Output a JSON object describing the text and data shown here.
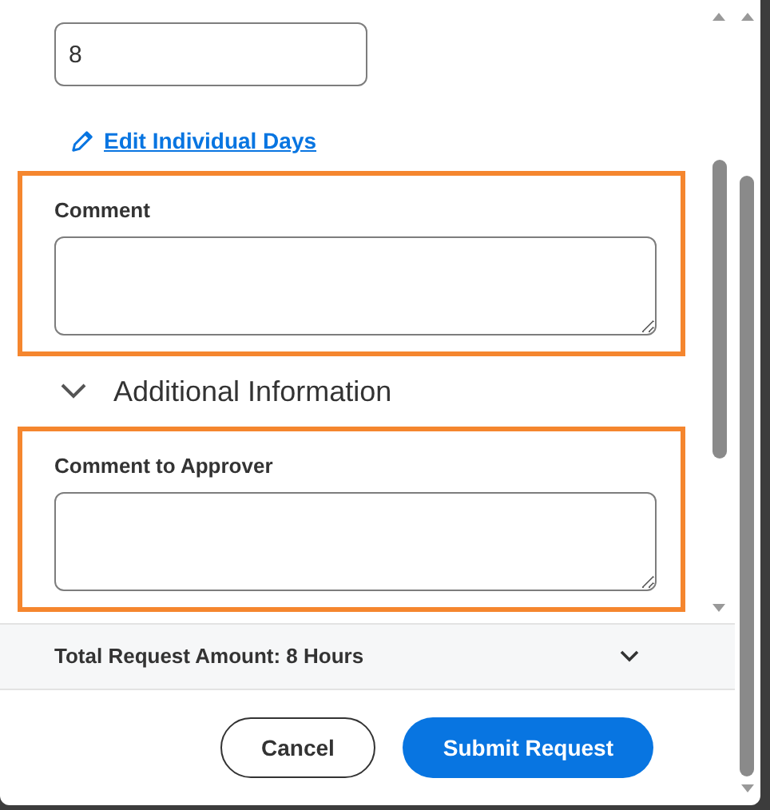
{
  "hours_field": {
    "value": "8"
  },
  "edit_link": {
    "label": "Edit Individual Days"
  },
  "sections": [
    {
      "label": "Comment",
      "highlighted": true
    },
    {
      "label": "Comment to Approver",
      "highlighted": true
    }
  ],
  "additional_information": {
    "label": "Additional Information",
    "expanded": false
  },
  "summary": {
    "text": "Total Request Amount: 8 Hours",
    "expanded": false
  },
  "buttons": [
    {
      "label": "Cancel",
      "kind": "secondary"
    },
    {
      "label": "Submit Request",
      "kind": "primary"
    }
  ]
}
